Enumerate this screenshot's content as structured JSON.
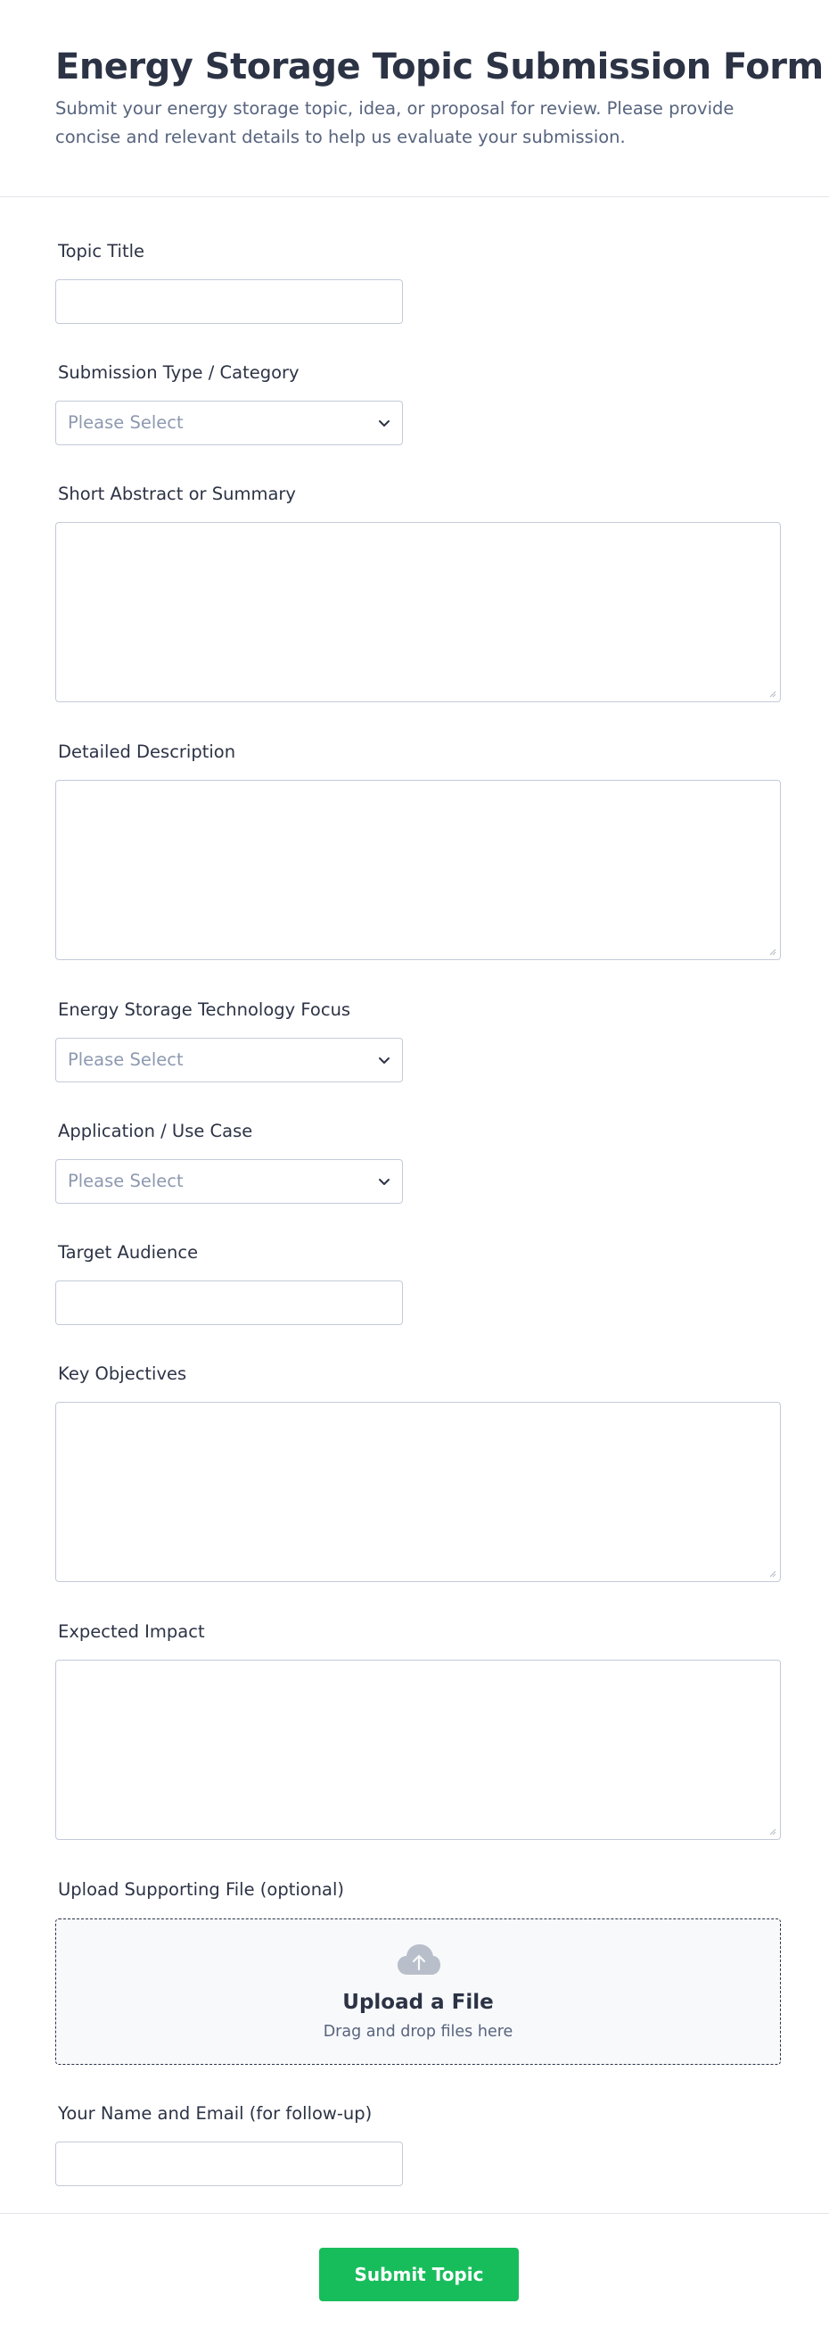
{
  "form": {
    "title": "Energy Storage Topic Submission Form",
    "subtitle": "Submit your energy storage topic, idea, or proposal for review. Please provide concise and relevant details to help us evaluate your submission."
  },
  "fields": {
    "topic_title": {
      "label": "Topic Title",
      "value": ""
    },
    "submission_type": {
      "label": "Submission Type / Category",
      "placeholder": "Please Select"
    },
    "abstract": {
      "label": "Short Abstract or Summary",
      "value": ""
    },
    "description": {
      "label": "Detailed Description",
      "value": ""
    },
    "technology_focus": {
      "label": "Energy Storage Technology Focus",
      "placeholder": "Please Select"
    },
    "application": {
      "label": "Application / Use Case",
      "placeholder": "Please Select"
    },
    "target_audience": {
      "label": "Target Audience",
      "value": ""
    },
    "key_objectives": {
      "label": "Key Objectives",
      "value": ""
    },
    "expected_impact": {
      "label": "Expected Impact",
      "value": ""
    },
    "upload": {
      "label": "Upload Supporting File (optional)",
      "title": "Upload a File",
      "subtitle": "Drag and drop files here"
    },
    "name_email": {
      "label": "Your Name and Email (for follow-up)",
      "value": ""
    }
  },
  "footer": {
    "submit_label": "Submit Topic"
  },
  "colors": {
    "text": "#2c3345",
    "muted": "#57647e",
    "border": "#c3cad8",
    "submit_bg": "#18bd5b",
    "upload_bg": "#f8f9fb"
  },
  "icons": {
    "select": "chevron-down-icon",
    "upload": "cloud-upload-icon",
    "resize": "resize-grip-icon"
  }
}
